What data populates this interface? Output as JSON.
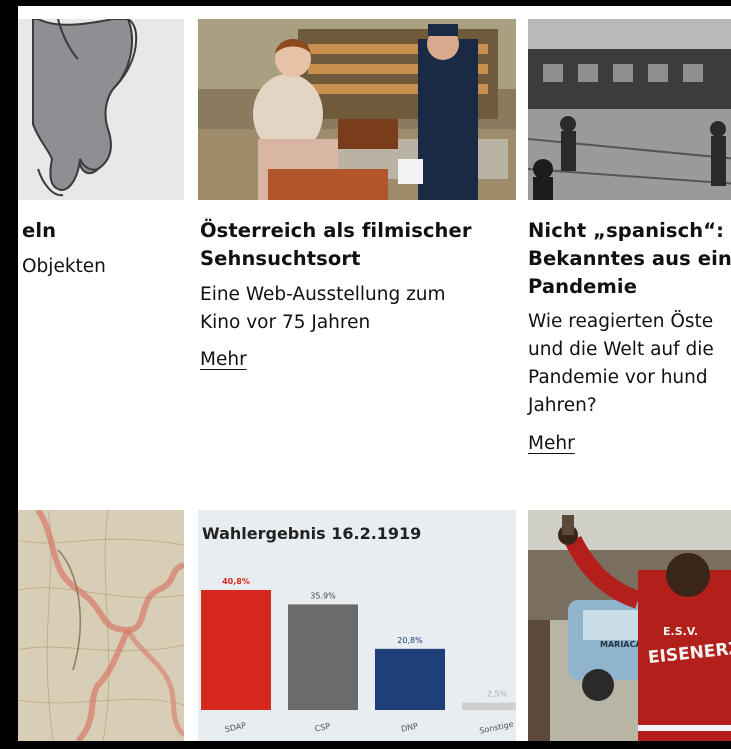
{
  "cards_row1": [
    {
      "id": "card-objects",
      "title_lines": [
        "eln"
      ],
      "desc_lines": [
        "Objekten"
      ],
      "image_alt": "elephant-illustration"
    },
    {
      "id": "card-film",
      "title_lines": [
        "Österreich als filmischer",
        "Sehnsuchtsort"
      ],
      "desc_lines": [
        "Eine Web-Ausstellung zum",
        "Kino vor 75 Jahren"
      ],
      "more_label": "Mehr",
      "image_alt": "film-still-bakery"
    },
    {
      "id": "card-pandemic",
      "title_lines": [
        "Nicht „spanisch“:",
        "Bekanntes aus ein",
        "Pandemie"
      ],
      "desc_lines": [
        "Wie reagierten Öste",
        "und die Welt auf die",
        "Pandemie vor hund",
        "Jahren?"
      ],
      "more_label": "Mehr",
      "image_alt": "historic-train-photo"
    }
  ],
  "election_chart": {
    "title": "Wahlergebnis 16.2.1919",
    "colors": {
      "SDAP": "#d7281e",
      "CSP": "#6b6b6b",
      "DNP": "#1f3f78",
      "Sonstige": "#cfcfcf"
    }
  },
  "chart_data": {
    "type": "bar",
    "title": "Wahlergebnis 16.2.1919",
    "categories": [
      "SDAP",
      "CSP",
      "DNP",
      "Sonstige"
    ],
    "values": [
      40.8,
      35.9,
      20.8,
      2.5
    ],
    "value_labels": [
      "40,8%",
      "35.9%",
      "20,8%",
      "2,5%"
    ],
    "xlabel": "",
    "ylabel": "",
    "ylim": [
      0,
      45
    ]
  },
  "photo_text": {
    "jersey": "E.S.V.",
    "jersey2": "EISENERZ",
    "car_text": "MARIACANA"
  }
}
